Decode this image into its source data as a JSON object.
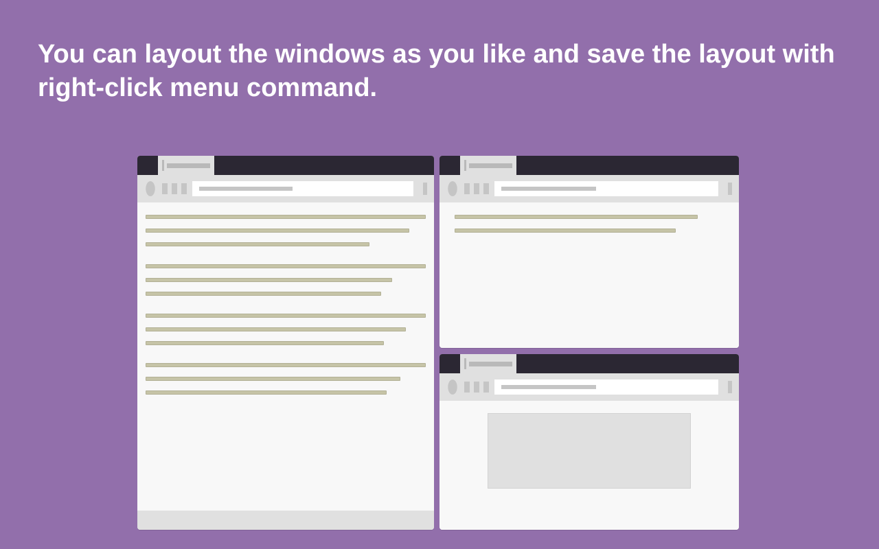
{
  "headline": "You can layout the windows as you like and save the layout with right-click menu command.",
  "windows": {
    "a": {
      "paragraphs": [
        {
          "lines": [
            100,
            94,
            80
          ]
        },
        {
          "lines": [
            100,
            88,
            84
          ]
        },
        {
          "lines": [
            100,
            93,
            85
          ]
        },
        {
          "lines": [
            100,
            91,
            86
          ]
        }
      ]
    },
    "b": {
      "paragraphs": [
        {
          "lines": [
            88,
            80
          ]
        }
      ]
    },
    "c": {
      "image": true
    }
  },
  "colors": {
    "background": "#926fab",
    "titlebar": "#2b2733",
    "chrome": "#e0e0e0",
    "surface": "#f8f8f8",
    "text_line": "#c6c4a7"
  }
}
